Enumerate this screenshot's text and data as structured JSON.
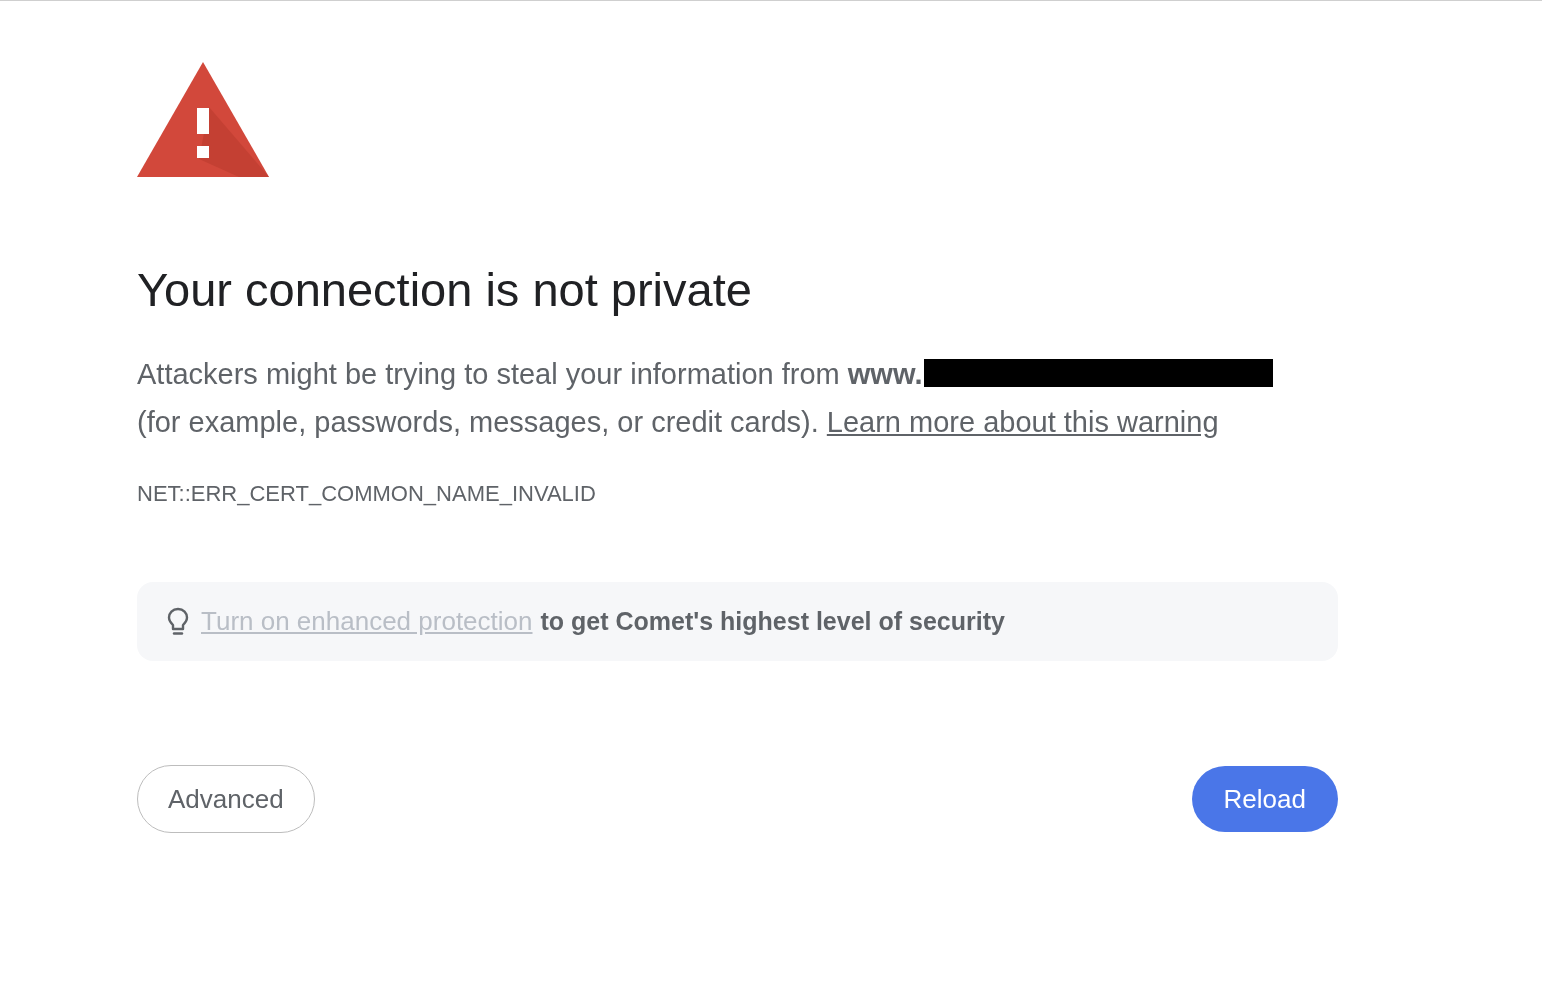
{
  "title": "Your connection is not private",
  "message": {
    "text_before": "Attackers might be trying to steal your information from **www.**",
    "text_after": "(for example, passwords, messages, or credit cards).",
    "link": "Learn more about this warning"
  },
  "error_code": "NET::ERR_CERT_COMMON_NAME_INVALID",
  "tip": {
    "link": "Turn on enhanced protection",
    "text": "to get Comet's highest level of security"
  },
  "buttons": [
    {
      "label": "Advanced",
      "kind": "secondary"
    },
    {
      "label": "Reload",
      "kind": "primary"
    }
  ]
}
